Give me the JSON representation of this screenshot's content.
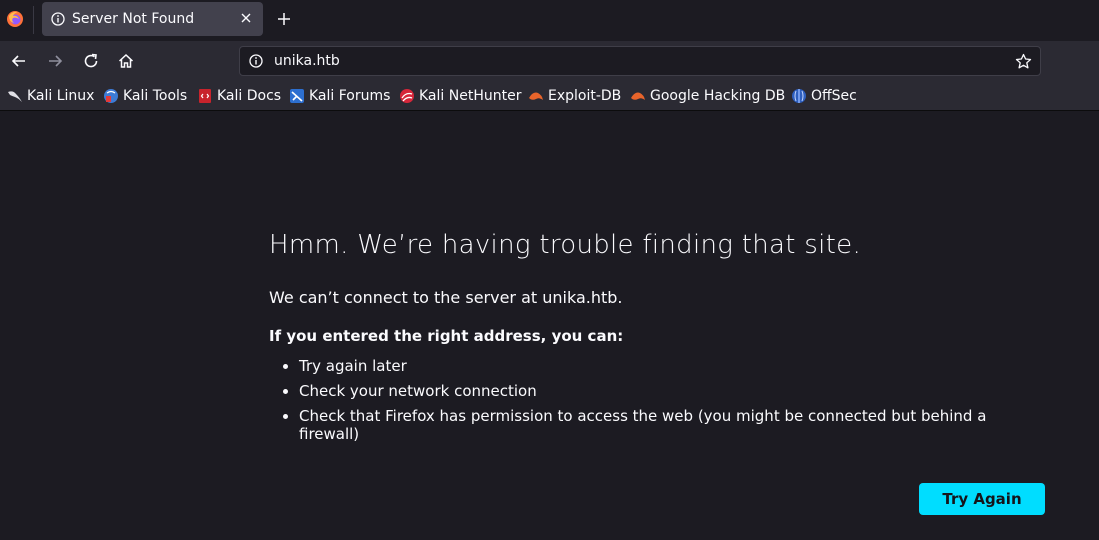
{
  "tab": {
    "title": "Server Not Found",
    "close_icon": "close-icon"
  },
  "toolbar": {
    "new_tab_icon": "plus-icon",
    "back_icon": "arrow-left-icon",
    "forward_icon": "arrow-right-icon",
    "reload_icon": "reload-icon",
    "home_icon": "home-icon"
  },
  "urlbar": {
    "value": "unika.htb",
    "info_icon": "info-icon",
    "bookmark_icon": "star-icon"
  },
  "bookmarks": [
    {
      "label": "Kali Linux",
      "icon": "kali-dragon-icon"
    },
    {
      "label": "Kali Tools",
      "icon": "kali-tools-icon"
    },
    {
      "label": "Kali Docs",
      "icon": "kali-docs-icon"
    },
    {
      "label": "Kali Forums",
      "icon": "kali-forums-icon"
    },
    {
      "label": "Kali NetHunter",
      "icon": "kali-nethunter-icon"
    },
    {
      "label": "Exploit-DB",
      "icon": "exploit-db-icon"
    },
    {
      "label": "Google Hacking DB",
      "icon": "ghdb-icon"
    },
    {
      "label": "OffSec",
      "icon": "offsec-icon"
    }
  ],
  "error": {
    "title": "Hmm. We’re having trouble finding that site.",
    "description": "We can’t connect to the server at unika.htb.",
    "subtitle": "If you entered the right address, you can:",
    "suggestions": [
      "Try again later",
      "Check your network connection",
      "Check that Firefox has permission to access the web (you might be connected but behind a firewall)"
    ],
    "button_label": "Try Again"
  },
  "colors": {
    "background": "#1c1b22",
    "toolbar": "#2b2a33",
    "tab_active": "#42414d",
    "accent": "#00ddff"
  }
}
